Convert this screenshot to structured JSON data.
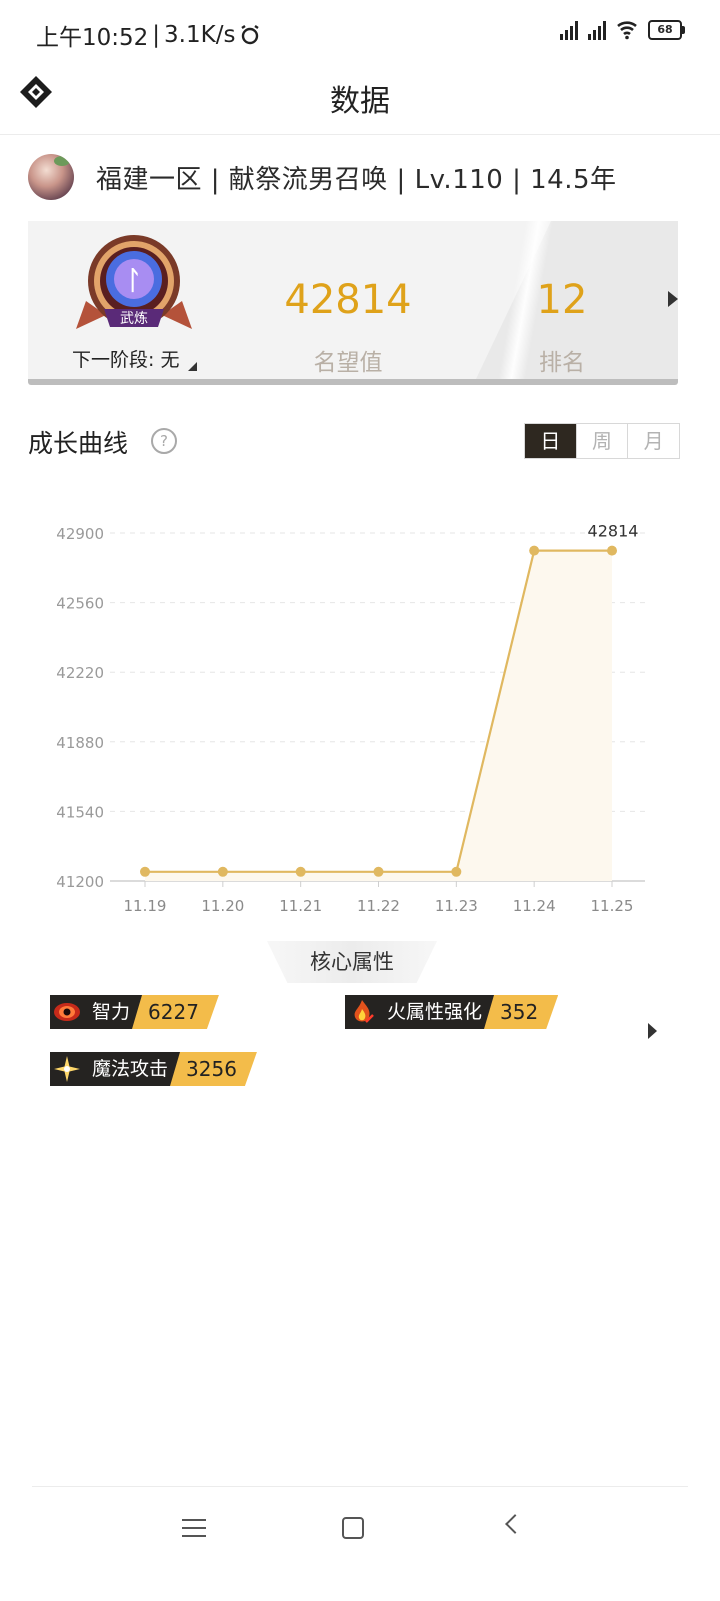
{
  "status_bar": {
    "time": "上午10:52",
    "net_speed": "3.1K/s",
    "battery": "68"
  },
  "header": {
    "title": "数据"
  },
  "profile": {
    "text": "福建一区 | 献祭流男召唤 | Lv.110 | 14.5年"
  },
  "stats": {
    "badge_text": "武炼",
    "next_stage": "下一阶段: 无",
    "reputation_value": "42814",
    "reputation_label": "名望值",
    "rank_value": "12",
    "rank_label": "排名"
  },
  "growth": {
    "title": "成长曲线",
    "help": "?",
    "tabs": [
      "日",
      "周",
      "月"
    ],
    "active_tab": "日"
  },
  "chart_data": {
    "type": "area",
    "x": [
      "11.19",
      "11.20",
      "11.21",
      "11.22",
      "11.23",
      "11.24",
      "11.25"
    ],
    "series": [
      {
        "values": [
          41245,
          41245,
          41245,
          41245,
          41245,
          42814,
          42814
        ]
      }
    ],
    "y_ticks": [
      41200,
      41540,
      41880,
      42220,
      42560,
      42900
    ],
    "ylim": [
      41200,
      42900
    ],
    "last_label": "42814",
    "line_color": "#e0b860",
    "fill_color": "#fdf8ee",
    "grid": true
  },
  "core": {
    "title": "核心属性",
    "attributes": [
      {
        "label": "智力",
        "value": "6227",
        "icon": "eye-icon"
      },
      {
        "label": "火属性强化",
        "value": "352",
        "icon": "fire-icon"
      },
      {
        "label": "魔法攻击",
        "value": "3256",
        "icon": "sparkle-icon"
      }
    ]
  },
  "colors": {
    "accent": "#dfa21a",
    "attr_value_bg": "#f3bc4a",
    "dark": "#2e2820"
  }
}
